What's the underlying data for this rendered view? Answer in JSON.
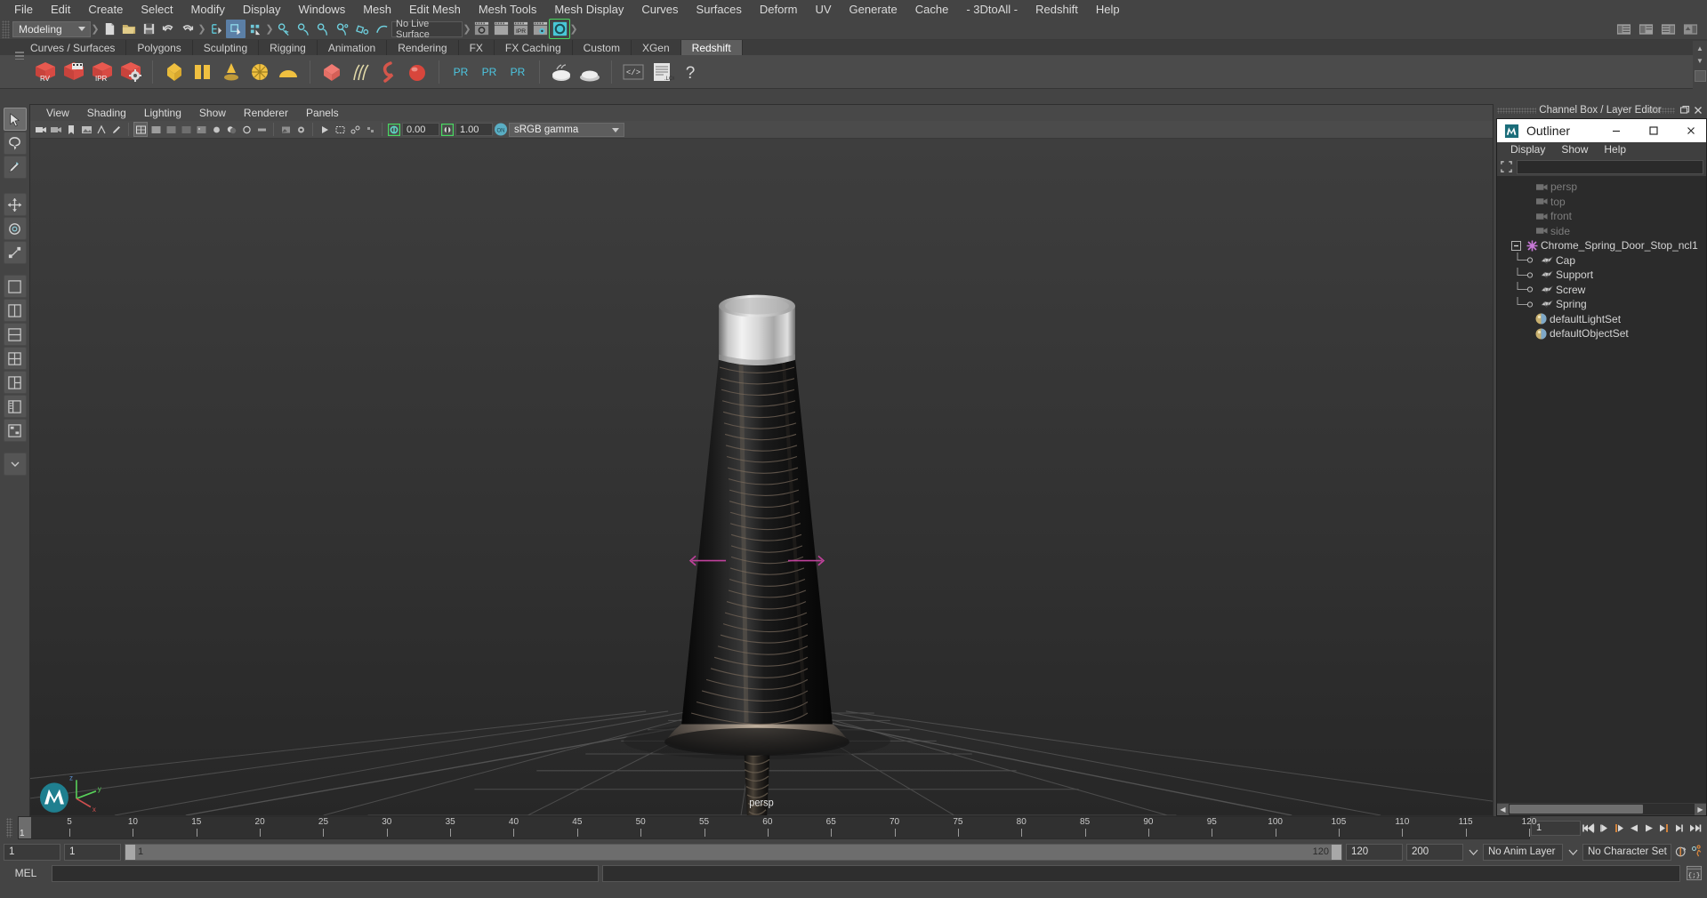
{
  "menubar": {
    "items": [
      "File",
      "Edit",
      "Create",
      "Select",
      "Modify",
      "Display",
      "Windows",
      "Mesh",
      "Edit Mesh",
      "Mesh Tools",
      "Mesh Display",
      "Curves",
      "Surfaces",
      "Deform",
      "UV",
      "Generate",
      "Cache",
      "- 3DtoAll -",
      "Redshift",
      "Help"
    ]
  },
  "statusline": {
    "menuset": "Modeling",
    "live_surface": "No Live Surface"
  },
  "shelf": {
    "tabs": [
      "Curves / Surfaces",
      "Polygons",
      "Sculpting",
      "Rigging",
      "Animation",
      "Rendering",
      "FX",
      "FX Caching",
      "Custom",
      "XGen",
      "Redshift"
    ],
    "active_tab": "Redshift",
    "icon_labels": [
      "RV",
      "IPR",
      "PR",
      "PR",
      "PR",
      ".LOG",
      "?"
    ]
  },
  "viewport": {
    "menu": [
      "View",
      "Shading",
      "Lighting",
      "Show",
      "Renderer",
      "Panels"
    ],
    "exposure": "0.00",
    "gamma": "1.00",
    "color_transform": "sRGB gamma",
    "camera_label": "persp",
    "axis_labels": {
      "x": "x",
      "y": "y",
      "z": "z"
    }
  },
  "rightdock": {
    "panel_title": "Channel Box / Layer Editor",
    "outliner": {
      "title": "Outliner",
      "menu": [
        "Display",
        "Show",
        "Help"
      ],
      "search_value": "",
      "items": [
        {
          "label": "persp",
          "type": "camera",
          "depth": 1,
          "dim": true
        },
        {
          "label": "top",
          "type": "camera",
          "depth": 1,
          "dim": true
        },
        {
          "label": "front",
          "type": "camera",
          "depth": 1,
          "dim": true
        },
        {
          "label": "side",
          "type": "camera",
          "depth": 1,
          "dim": true
        },
        {
          "label": "Chrome_Spring_Door_Stop_ncl1",
          "type": "group",
          "depth": 0,
          "expanded": true,
          "dim": false
        },
        {
          "label": "Cap",
          "type": "mesh",
          "depth": 2,
          "dim": false
        },
        {
          "label": "Support",
          "type": "mesh",
          "depth": 2,
          "dim": false
        },
        {
          "label": "Screw",
          "type": "mesh",
          "depth": 2,
          "dim": false
        },
        {
          "label": "Spring",
          "type": "mesh",
          "depth": 2,
          "dim": false
        },
        {
          "label": "defaultLightSet",
          "type": "set",
          "depth": 1,
          "dim": false
        },
        {
          "label": "defaultObjectSet",
          "type": "set",
          "depth": 1,
          "dim": false
        }
      ]
    }
  },
  "timeline": {
    "current_frame": "1",
    "tick_labels": [
      "5",
      "10",
      "15",
      "20",
      "25",
      "30",
      "35",
      "40",
      "45",
      "50",
      "55",
      "60",
      "65",
      "70",
      "75",
      "80",
      "85",
      "90",
      "95",
      "100",
      "105",
      "110",
      "115",
      "120"
    ],
    "tick_values": [
      5,
      10,
      15,
      20,
      25,
      30,
      35,
      40,
      45,
      50,
      55,
      60,
      65,
      70,
      75,
      80,
      85,
      90,
      95,
      100,
      105,
      110,
      115,
      120
    ],
    "range_min": 1,
    "range_max": 120,
    "end_field": "1"
  },
  "rangeslider": {
    "anim_start": "1",
    "range_start": "1",
    "bar_start_label": "1",
    "bar_end_label": "120",
    "range_end": "120",
    "anim_end": "200",
    "anim_layer": "No Anim Layer",
    "character_set": "No Character Set"
  },
  "mel": {
    "label": "MEL",
    "command": "",
    "output": ""
  },
  "colors": {
    "accent_blue": "#5b7fa6",
    "highlight_green": "#49d861",
    "shelf_active": "#5e5e5e",
    "panel_bg": "#444444",
    "viewport_bg": "#333333",
    "outliner_bg": "#2b2b2b",
    "orange": "#e08a3c"
  }
}
